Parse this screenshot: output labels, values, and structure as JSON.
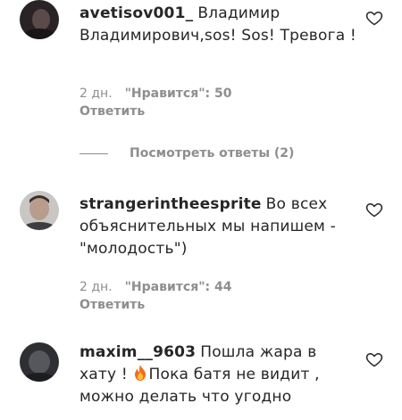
{
  "comments": [
    {
      "username": "avetisov001_",
      "text": "Владимир Владимирович,sos! Sos! Тревога !",
      "age": "2 дн.",
      "likes": "\"Нравится\": 50",
      "reply": "Ответить"
    },
    {
      "username": "strangerintheesprite",
      "text": "Во всех объяснительных мы напишем - \"молодость\")",
      "age": "2 дн.",
      "likes": "\"Нравится\": 44",
      "reply": "Ответить"
    },
    {
      "username": "maxim__9603",
      "text_before_emoji": "Пошла жара в хату !",
      "emoji": "fire-emoji",
      "text_after_emoji": "Пока батя не видит , можно делать что угодно"
    }
  ],
  "view_replies": "Посмотреть ответы (2)",
  "icons": {
    "like": "heart-icon"
  },
  "colors": {
    "text": "#262626",
    "secondary": "#8e8e8e"
  }
}
